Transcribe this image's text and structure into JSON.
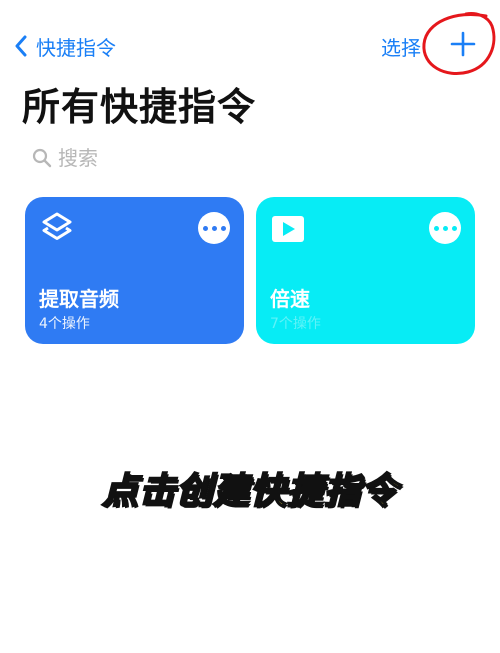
{
  "nav": {
    "back_label": "快捷指令",
    "select_label": "选择",
    "add_icon": "plus-icon"
  },
  "page_title": "所有快捷指令",
  "search": {
    "placeholder": "搜索",
    "icon": "search-icon"
  },
  "shortcuts": [
    {
      "title": "提取音频",
      "subtitle": "4个操作",
      "color": "#2f7bf3",
      "icon": "layers-icon"
    },
    {
      "title": "倍速",
      "subtitle": "7个操作",
      "color": "#07ecf5",
      "icon": "play-icon"
    }
  ],
  "caption": "点击创建快捷指令",
  "colors": {
    "accent": "#1a7ff6",
    "annotation": "#e5171c",
    "caption": "#ffe94a"
  }
}
